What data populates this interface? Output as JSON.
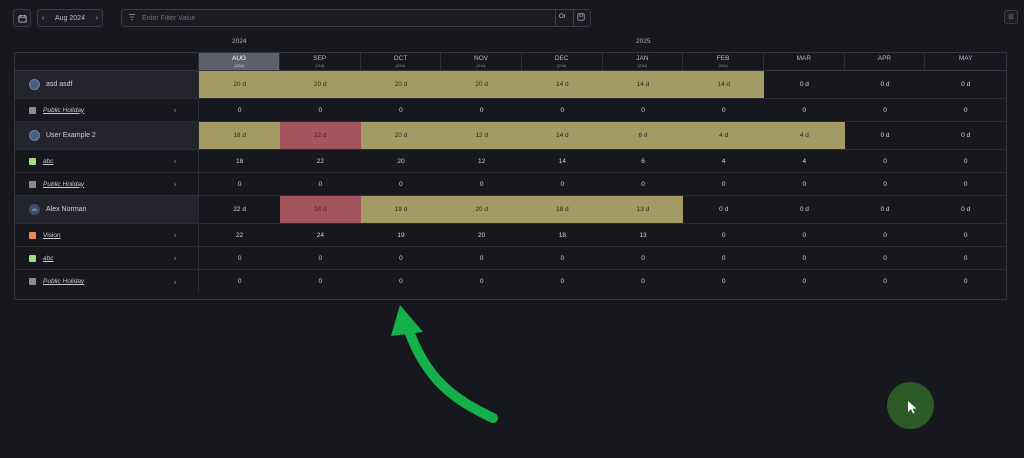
{
  "toolbar": {
    "calendar_icon": "calendar-icon",
    "month": "Aug 2024",
    "prev": "‹",
    "next": "›"
  },
  "filter": {
    "placeholder": "Enter Filter Value",
    "or_label": "Or"
  },
  "years": [
    "2024",
    "2025"
  ],
  "months": [
    {
      "label": "AUG",
      "days": "(22d)",
      "current": true
    },
    {
      "label": "SEP",
      "days": "(21d)",
      "current": false
    },
    {
      "label": "OCT",
      "days": "(23d)",
      "current": false
    },
    {
      "label": "NOV",
      "days": "(21d)",
      "current": false
    },
    {
      "label": "DEC",
      "days": "(22d)",
      "current": false
    },
    {
      "label": "JAN",
      "days": "(23d)",
      "current": false
    },
    {
      "label": "FEB",
      "days": "(20d)",
      "current": false
    },
    {
      "label": "MAR",
      "days": "",
      "current": false
    },
    {
      "label": "APR",
      "days": "",
      "current": false
    },
    {
      "label": "MAY",
      "days": "",
      "current": false
    }
  ],
  "rows": [
    {
      "type": "user",
      "name": "asd asdf",
      "avatar": "globe",
      "cells": [
        [
          "20 d",
          "olive"
        ],
        [
          "20 d",
          "olive"
        ],
        [
          "20 d",
          "olive"
        ],
        [
          "20 d",
          "olive"
        ],
        [
          "14 d",
          "olive"
        ],
        [
          "14 d",
          "olive"
        ],
        [
          "14 d",
          "olive"
        ],
        [
          "0 d",
          ""
        ],
        [
          "0 d",
          ""
        ],
        [
          "0 d",
          ""
        ]
      ]
    },
    {
      "type": "sub",
      "name": "Public Holiday",
      "swatch": "#8b8c93",
      "italic": true,
      "cells": [
        [
          "0",
          ""
        ],
        [
          "0",
          ""
        ],
        [
          "0",
          ""
        ],
        [
          "0",
          ""
        ],
        [
          "0",
          ""
        ],
        [
          "0",
          ""
        ],
        [
          "0",
          ""
        ],
        [
          "0",
          ""
        ],
        [
          "0",
          ""
        ],
        [
          "0",
          ""
        ]
      ]
    },
    {
      "type": "user",
      "name": "User Example 2",
      "avatar": "globe",
      "cells": [
        [
          "18 d",
          "olive"
        ],
        [
          "22 d",
          "red"
        ],
        [
          "20 d",
          "olive"
        ],
        [
          "12 d",
          "olive"
        ],
        [
          "14 d",
          "olive"
        ],
        [
          "6 d",
          "olive"
        ],
        [
          "4 d",
          "olive"
        ],
        [
          "4 d",
          "olive"
        ],
        [
          "0 d",
          ""
        ],
        [
          "0 d",
          ""
        ]
      ]
    },
    {
      "type": "sub",
      "name": "abc",
      "swatch": "#9fe07a",
      "italic": true,
      "cells": [
        [
          "18",
          ""
        ],
        [
          "22",
          ""
        ],
        [
          "20",
          ""
        ],
        [
          "12",
          ""
        ],
        [
          "14",
          ""
        ],
        [
          "6",
          ""
        ],
        [
          "4",
          ""
        ],
        [
          "4",
          ""
        ],
        [
          "0",
          ""
        ],
        [
          "0",
          ""
        ]
      ]
    },
    {
      "type": "sub",
      "name": "Public Holiday",
      "swatch": "#8b8c93",
      "italic": true,
      "cells": [
        [
          "0",
          ""
        ],
        [
          "0",
          ""
        ],
        [
          "0",
          ""
        ],
        [
          "0",
          ""
        ],
        [
          "0",
          ""
        ],
        [
          "0",
          ""
        ],
        [
          "0",
          ""
        ],
        [
          "0",
          ""
        ],
        [
          "0",
          ""
        ],
        [
          "0",
          ""
        ]
      ]
    },
    {
      "type": "user",
      "name": "Alex Norman",
      "avatar": "initials",
      "initials": "AN",
      "cells": [
        [
          "22 d",
          ""
        ],
        [
          "24 d",
          "red"
        ],
        [
          "19 d",
          "olive"
        ],
        [
          "20 d",
          "olive"
        ],
        [
          "18 d",
          "olive"
        ],
        [
          "13 d",
          "olive"
        ],
        [
          "0 d",
          ""
        ],
        [
          "0 d",
          ""
        ],
        [
          "0 d",
          ""
        ],
        [
          "0 d",
          ""
        ]
      ]
    },
    {
      "type": "sub",
      "name": "Vision",
      "swatch": "#e88b4c",
      "italic": false,
      "cells": [
        [
          "22",
          ""
        ],
        [
          "24",
          ""
        ],
        [
          "19",
          ""
        ],
        [
          "20",
          ""
        ],
        [
          "18",
          ""
        ],
        [
          "13",
          ""
        ],
        [
          "0",
          ""
        ],
        [
          "0",
          ""
        ],
        [
          "0",
          ""
        ],
        [
          "0",
          ""
        ]
      ]
    },
    {
      "type": "sub",
      "name": "abc",
      "swatch": "#9fe07a",
      "italic": true,
      "cells": [
        [
          "0",
          ""
        ],
        [
          "0",
          ""
        ],
        [
          "0",
          ""
        ],
        [
          "0",
          ""
        ],
        [
          "0",
          ""
        ],
        [
          "0",
          ""
        ],
        [
          "0",
          ""
        ],
        [
          "0",
          ""
        ],
        [
          "0",
          ""
        ],
        [
          "0",
          ""
        ]
      ]
    },
    {
      "type": "sub",
      "name": "Public Holiday",
      "swatch": "#8b8c93",
      "italic": true,
      "cells": [
        [
          "0",
          ""
        ],
        [
          "0",
          ""
        ],
        [
          "0",
          ""
        ],
        [
          "0",
          ""
        ],
        [
          "0",
          ""
        ],
        [
          "0",
          ""
        ],
        [
          "0",
          ""
        ],
        [
          "0",
          ""
        ],
        [
          "0",
          ""
        ],
        [
          "0",
          ""
        ]
      ]
    }
  ],
  "colors": {
    "background": "#17181e",
    "allocation_olive": "#a39a64",
    "over_allocation_red": "#a3545d",
    "annotation_arrow": "#14b04a",
    "cursor_highlight": "#2d5b27"
  }
}
